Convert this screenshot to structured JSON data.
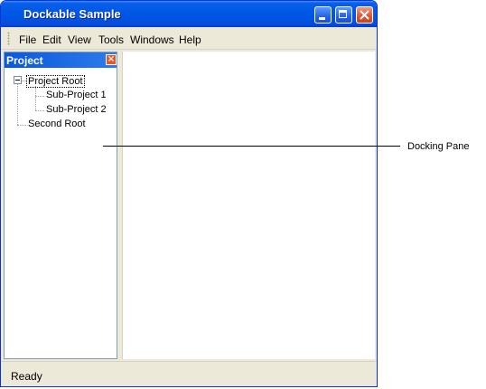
{
  "window": {
    "title": "Dockable Sample"
  },
  "menu": {
    "items": [
      {
        "label": "File"
      },
      {
        "label": "Edit"
      },
      {
        "label": "View"
      },
      {
        "label": "Tools"
      },
      {
        "label": "Windows"
      },
      {
        "label": "Help"
      }
    ]
  },
  "project_panel": {
    "title": "Project",
    "close_glyph": "×",
    "tree": {
      "nodes": [
        {
          "label": "Project Root"
        },
        {
          "label": "Sub-Project 1"
        },
        {
          "label": "Sub-Project 2"
        },
        {
          "label": "Second Root"
        }
      ]
    }
  },
  "status": {
    "text": "Ready"
  },
  "annotation": {
    "label": "Docking Pane"
  },
  "colors": {
    "titlebar": "#0054e3",
    "panel_header": "#0a58de",
    "chrome": "#ece9d8"
  },
  "icons": [
    "minimize-icon",
    "maximize-icon",
    "close-icon",
    "panel-close-icon",
    "tree-collapse-icon"
  ]
}
